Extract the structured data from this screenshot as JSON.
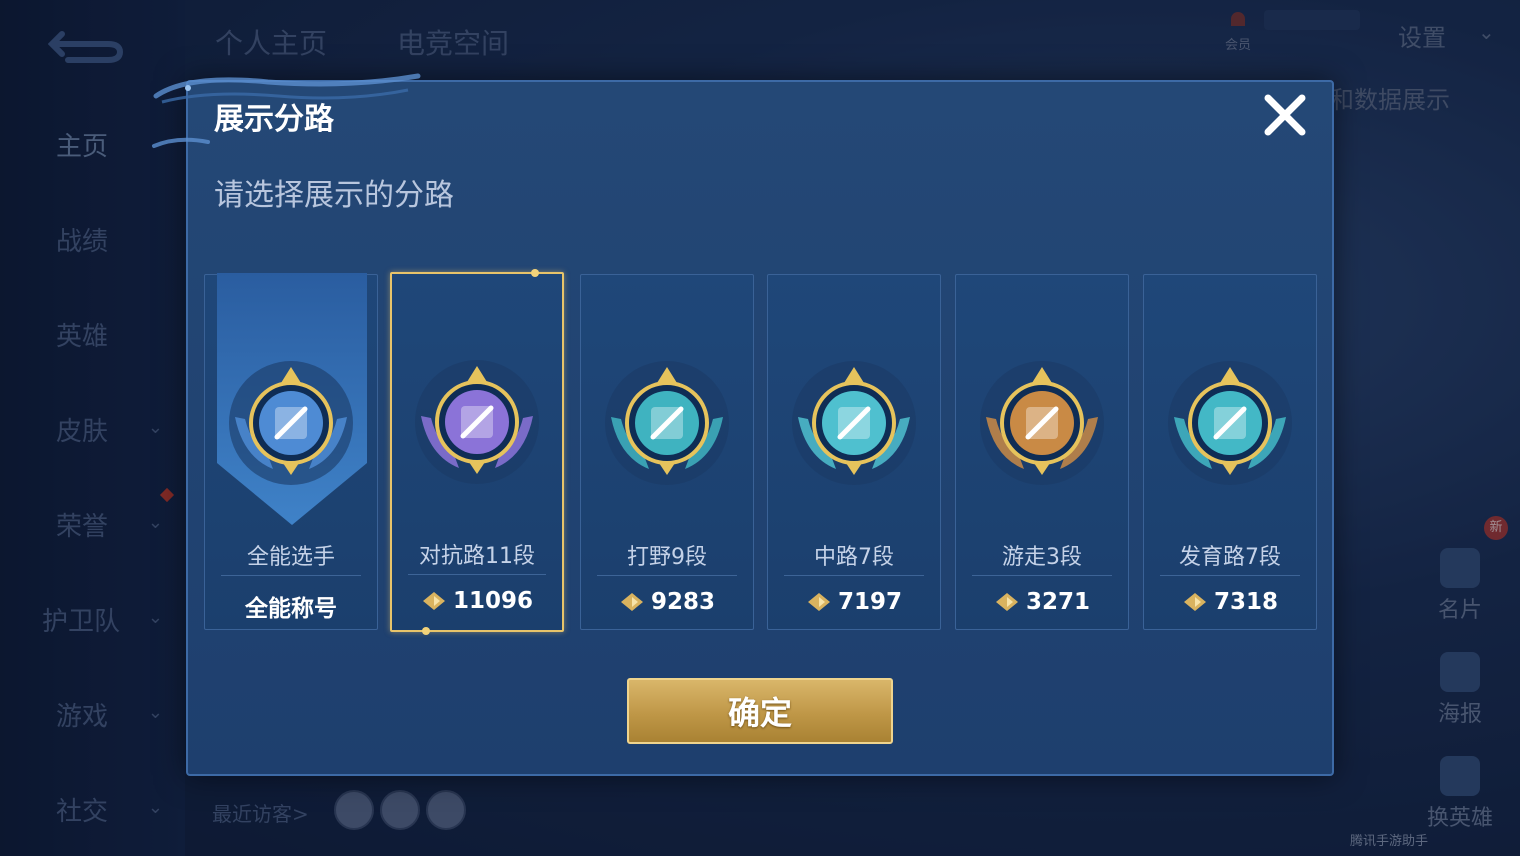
{
  "background": {
    "tabs": [
      "个人主页",
      "电竞空间"
    ],
    "nav": [
      {
        "label": "主页",
        "chevron": false
      },
      {
        "label": "战绩",
        "chevron": false
      },
      {
        "label": "英雄",
        "chevron": false
      },
      {
        "label": "皮肤",
        "chevron": true
      },
      {
        "label": "荣誉",
        "chevron": true
      },
      {
        "label": "护卫队",
        "chevron": true
      },
      {
        "label": "游戏",
        "chevron": true
      },
      {
        "label": "社交",
        "chevron": true
      }
    ],
    "settings": "设置",
    "vip_label": "会员",
    "data_show": "和数据展示",
    "side_buttons": [
      "名片",
      "海报",
      "换英雄"
    ],
    "new_tag": "新",
    "recent_visitors": "最近访客>",
    "watermark": "腾讯手游助手"
  },
  "modal": {
    "title": "展示分路",
    "subtitle": "请选择展示的分路",
    "confirm": "确定",
    "cards": [
      {
        "label": "全能选手",
        "score": "全能称号",
        "emblem": "all-round-badge-icon",
        "color": "#4e8bd4",
        "selected": false
      },
      {
        "label": "对抗路11段",
        "score": "11096",
        "emblem": "clash-lane-badge-icon",
        "color": "#8b73d8",
        "selected": true
      },
      {
        "label": "打野9段",
        "score": "9283",
        "emblem": "jungle-badge-icon",
        "color": "#3fb3c0",
        "selected": false
      },
      {
        "label": "中路7段",
        "score": "7197",
        "emblem": "mid-lane-badge-icon",
        "color": "#4fc0cf",
        "selected": false
      },
      {
        "label": "游走3段",
        "score": "3271",
        "emblem": "roam-badge-icon",
        "color": "#c98a45",
        "selected": false
      },
      {
        "label": "发育路7段",
        "score": "7318",
        "emblem": "farm-lane-badge-icon",
        "color": "#43b8c6",
        "selected": false
      }
    ]
  }
}
